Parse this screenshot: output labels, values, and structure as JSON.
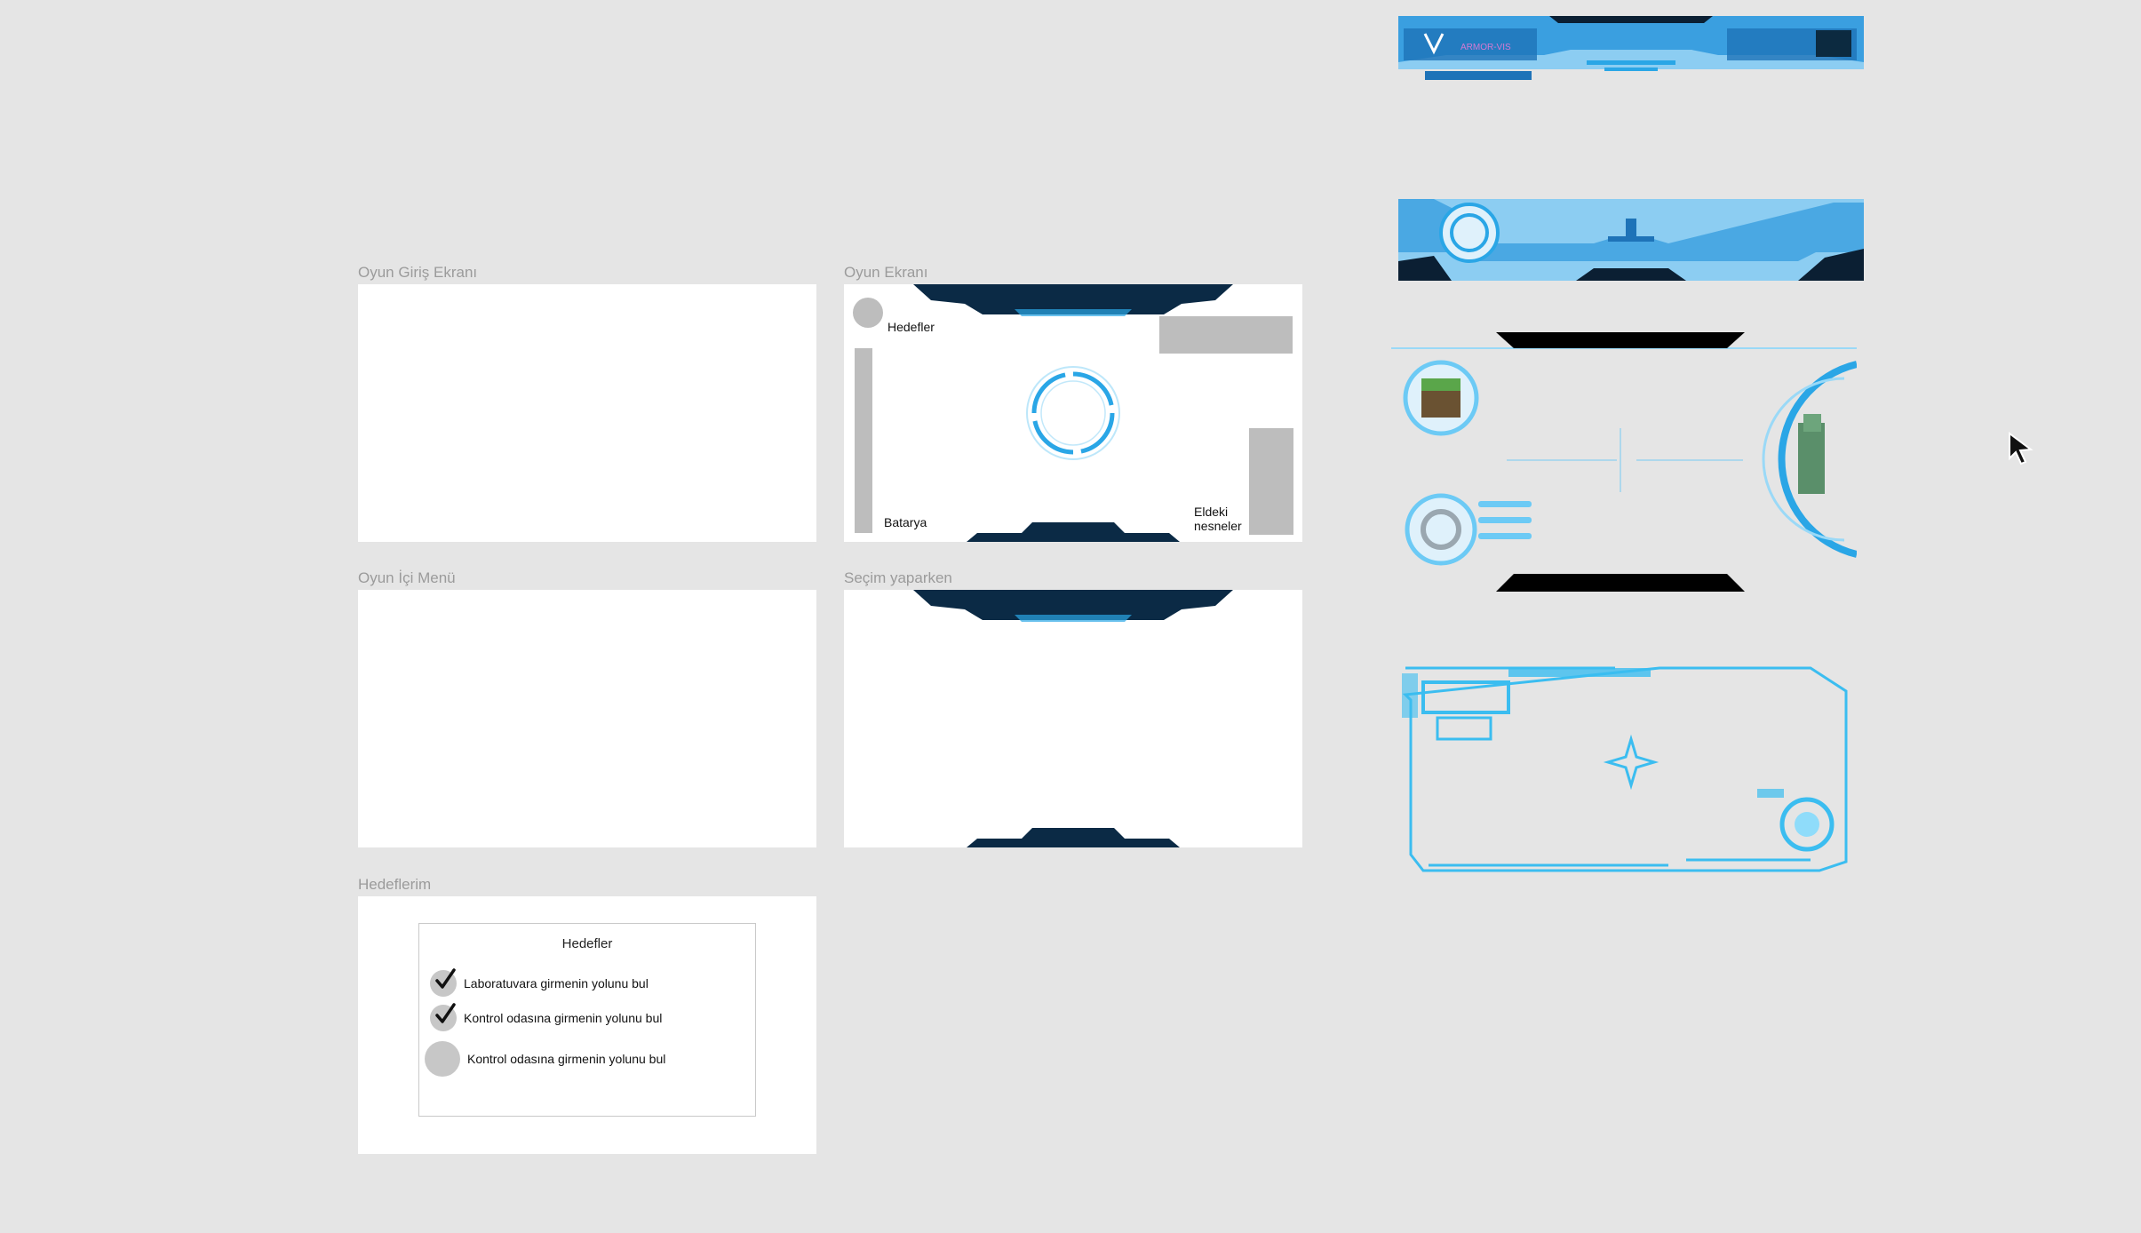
{
  "frames": {
    "start_screen": {
      "label": "Oyun Giriş Ekranı"
    },
    "game_screen": {
      "label": "Oyun Ekranı",
      "goals_label": "Hedefler",
      "battery_label": "Batarya",
      "items_label_line1": "Eldeki",
      "items_label_line2": "nesneler"
    },
    "in_game_menu": {
      "label": "Oyun İçi Menü"
    },
    "selecting": {
      "label": "Seçim yaparken"
    },
    "my_goals": {
      "label": "Hedeflerim",
      "box_title": "Hedefler",
      "goals": [
        {
          "text": "Laboratuvara girmenin yolunu bul",
          "done": true
        },
        {
          "text": "Kontrol odasına girmenin yolunu bul",
          "done": true
        },
        {
          "text": "Kontrol odasına girmenin yolunu bul",
          "done": false
        }
      ]
    }
  },
  "assets": {
    "hud_banner_text": "ARMOR-VIS"
  },
  "colors": {
    "canvas": "#e5e5e5",
    "hud_dark": "#0b2a45",
    "hud_blue": "#2aa6e6",
    "hud_glow": "#6ccaf5",
    "placeholder_gray": "#bdbdbd"
  }
}
